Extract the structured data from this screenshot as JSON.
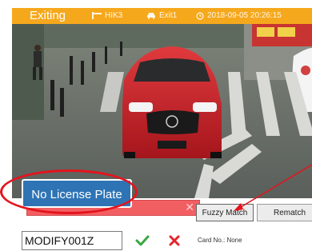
{
  "header": {
    "state": "Exiting",
    "lane": "HIK3",
    "exit": "Exit1",
    "datetime": "2018-09-05 20:26:15"
  },
  "plate_bar": {
    "fuzzy_label": "Fuzzy Match",
    "rematch_label": "Rematch"
  },
  "callout": {
    "text": "No License Plate"
  },
  "bottom": {
    "plate_value": "MODIFY001Z",
    "card_no": "Card No.: None"
  },
  "colors": {
    "header_bg": "#f6a81c",
    "plate_bar_red": "#f25f63",
    "callout_bg": "#2e74b5",
    "annotation_red": "#e4141c",
    "confirm_green": "#3aa845",
    "cancel_red": "#e3252b"
  },
  "icons": {
    "lane": "gate-icon",
    "exit": "car-icon",
    "time": "clock-icon",
    "confirm": "check-icon",
    "cancel": "close-icon"
  }
}
